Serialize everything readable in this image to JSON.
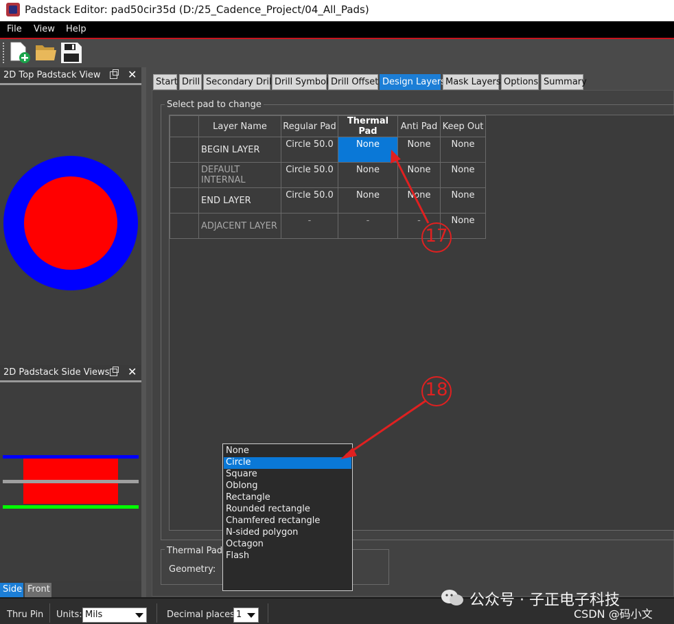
{
  "window": {
    "title": "Padstack Editor: pad50cir35d  (D:/25_Cadence_Project/04_All_Pads)"
  },
  "menu": [
    "File",
    "View",
    "Help"
  ],
  "toolbar": {
    "icons": [
      "new-icon",
      "open-folder-icon",
      "save-icon"
    ]
  },
  "left_panels": {
    "top_view_title": "2D Top Padstack View",
    "side_view_title": "2D Padstack Side Views",
    "view_tabs": [
      "Side",
      "Front"
    ],
    "colors": {
      "outer": "#0000ff",
      "inner": "#ff0000",
      "middle_line": "#a0a0a0",
      "bottom_line": "#00ff00"
    }
  },
  "tabs": [
    {
      "label": "Start",
      "active": false
    },
    {
      "label": "Drill",
      "active": false
    },
    {
      "label": "Secondary Drill",
      "active": false
    },
    {
      "label": "Drill Symbol",
      "active": false
    },
    {
      "label": "Drill Offset",
      "active": false
    },
    {
      "label": "Design Layers",
      "active": true
    },
    {
      "label": "Mask Layers",
      "active": false
    },
    {
      "label": "Options",
      "active": false
    },
    {
      "label": "Summary",
      "active": false
    }
  ],
  "select_group": {
    "title": "Select pad to change",
    "columns": [
      "Layer Name",
      "Regular Pad",
      "Thermal Pad",
      "Anti Pad",
      "Keep Out"
    ],
    "rows": [
      {
        "layer": "BEGIN LAYER",
        "regular": "Circle 50.0",
        "thermal": "None",
        "anti": "None",
        "keepout": "None"
      },
      {
        "layer": "DEFAULT INTERNAL",
        "regular": "Circle 50.0",
        "thermal": "None",
        "anti": "None",
        "keepout": "None"
      },
      {
        "layer": "END LAYER",
        "regular": "Circle 50.0",
        "thermal": "None",
        "anti": "None",
        "keepout": "None"
      },
      {
        "layer": "ADJACENT LAYER",
        "regular": "-",
        "thermal": "-",
        "anti": "-",
        "keepout": "None"
      }
    ]
  },
  "thermal_group": {
    "title": "Thermal Pad",
    "geometry_label": "Geometry:"
  },
  "geometry_dropdown": {
    "options": [
      "None",
      "Circle",
      "Square",
      "Oblong",
      "Rectangle",
      "Rounded rectangle",
      "Chamfered rectangle",
      "N-sided polygon",
      "Octagon",
      "Flash"
    ],
    "selected": "Circle"
  },
  "status": {
    "pin_type": "Thru Pin",
    "units_label": "Units:",
    "units_value": "Mils",
    "decimal_label": "Decimal places:",
    "decimal_value": "1"
  },
  "annotations": {
    "a17": "17",
    "a18": "18",
    "annotation_color": "#e02020"
  },
  "watermark": {
    "line1": "公众号 · 子正电子科技",
    "line2": "CSDN @码小文"
  }
}
